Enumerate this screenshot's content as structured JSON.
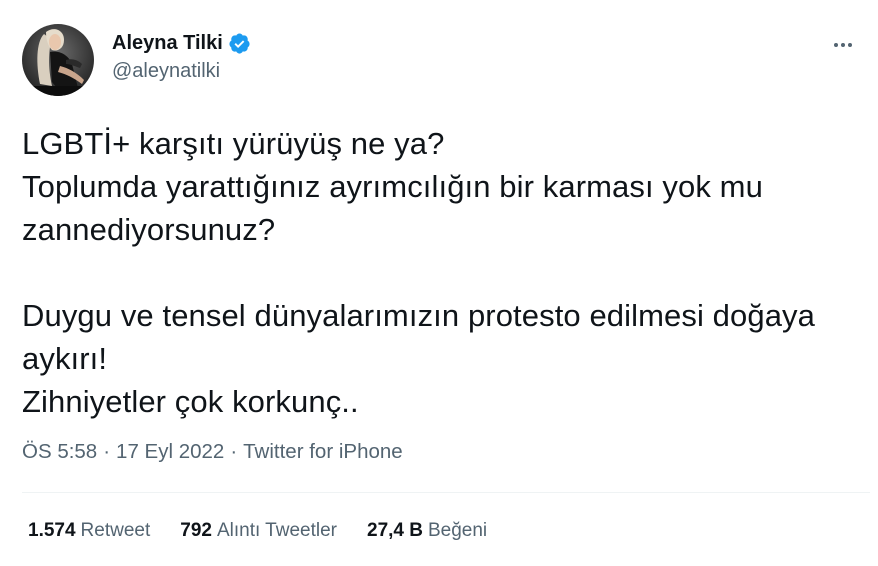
{
  "author": {
    "display_name": "Aleyna Tilki",
    "handle": "@aleynatilki",
    "verified": true
  },
  "icons": {
    "verified": "verified-badge-icon",
    "more": "more-options-icon"
  },
  "tweet": {
    "text": "LGBTİ+ karşıtı yürüyüş ne ya?\nToplumda yarattığınız ayrımcılığın bir karması yok mu zannediyorsunuz?\n\nDuygu ve tensel dünyalarımızın protesto edilmesi doğaya aykırı!\nZihniyetler çok korkunç..",
    "time": "ÖS 5:58",
    "date": "17 Eyl 2022",
    "source": "Twitter for iPhone",
    "separator": "·"
  },
  "stats": {
    "retweets": {
      "count": "1.574",
      "label": "Retweet"
    },
    "quotes": {
      "count": "792",
      "label": "Alıntı Tweetler"
    },
    "likes": {
      "count": "27,4 B",
      "label": "Beğeni"
    }
  },
  "colors": {
    "text": "#0f1419",
    "secondary": "#536471",
    "verified": "#1d9bf0",
    "divider": "#eff3f4"
  }
}
